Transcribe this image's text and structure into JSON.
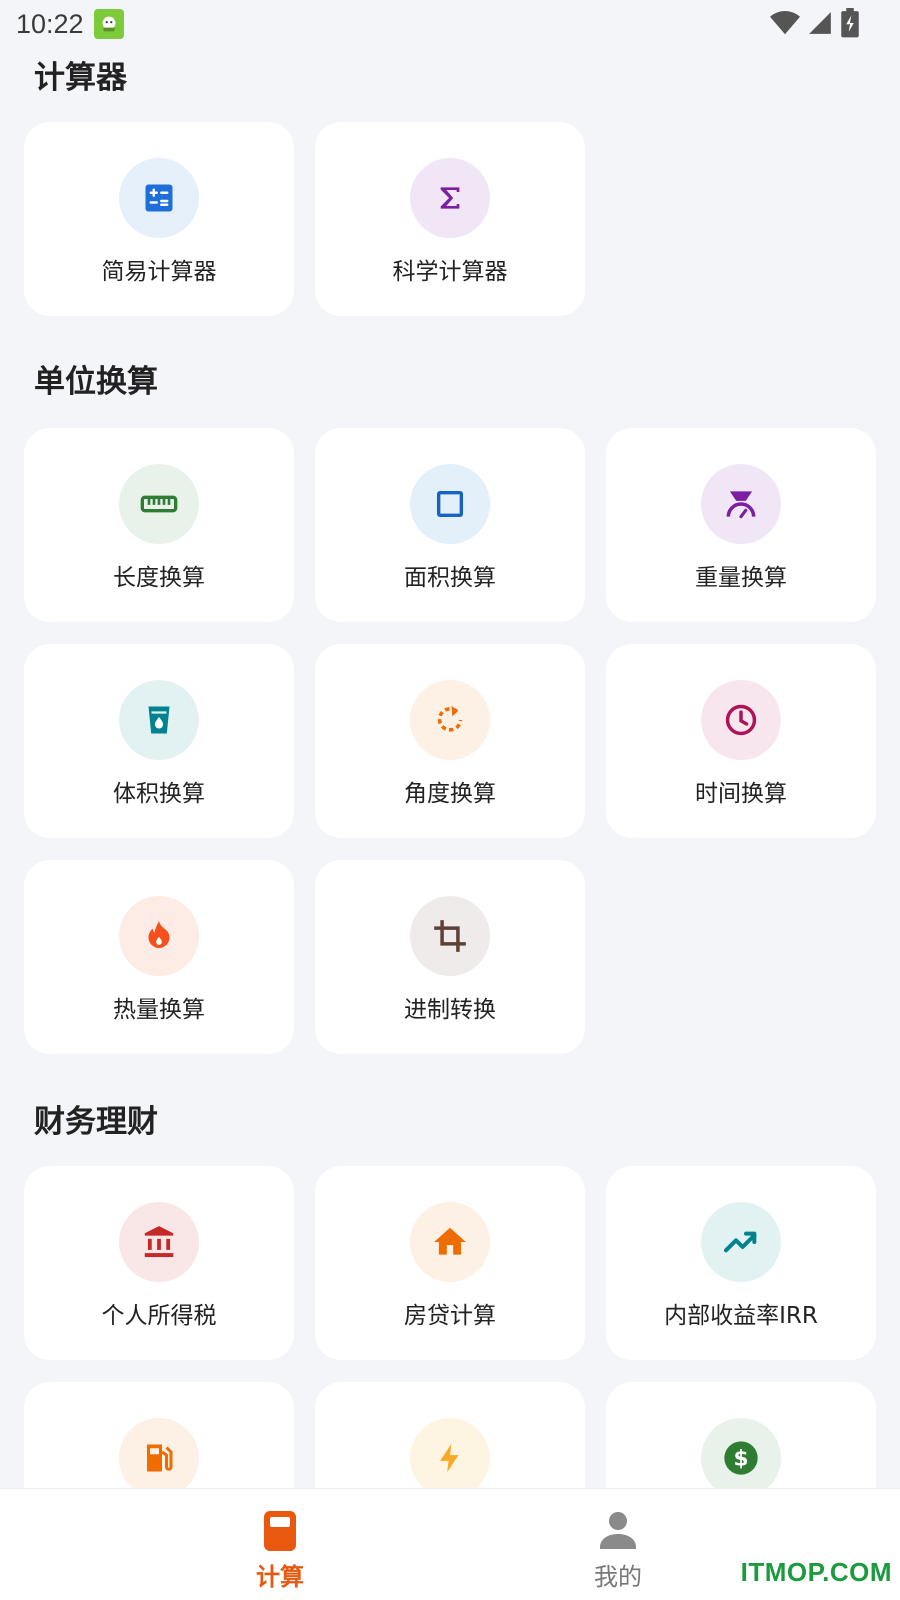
{
  "status_bar": {
    "time": "10:22",
    "icons": [
      "app-notification-icon",
      "wifi-icon",
      "cellular-signal-icon",
      "battery-charging-icon"
    ]
  },
  "sections": [
    {
      "title": "计算器",
      "items": [
        {
          "label": "简易计算器",
          "icon": "calculator-icon",
          "color": "#1e6fd9",
          "bg": "#e6f0fb"
        },
        {
          "label": "科学计算器",
          "icon": "sigma-icon",
          "color": "#7b1fa2",
          "bg": "#f1e6f6"
        }
      ]
    },
    {
      "title": "单位换算",
      "items": [
        {
          "label": "长度换算",
          "icon": "ruler-icon",
          "color": "#2e7d32",
          "bg": "#e8f2ea"
        },
        {
          "label": "面积换算",
          "icon": "square-icon",
          "color": "#1565c0",
          "bg": "#e3eff9"
        },
        {
          "label": "重量换算",
          "icon": "scale-icon",
          "color": "#7b1fa2",
          "bg": "#f1e6f6"
        },
        {
          "label": "体积换算",
          "icon": "cup-icon",
          "color": "#00838f",
          "bg": "#e2f2f3"
        },
        {
          "label": "角度换算",
          "icon": "rotate-icon",
          "color": "#ef6c00",
          "bg": "#fdf0e4"
        },
        {
          "label": "时间换算",
          "icon": "clock-icon",
          "color": "#ad1457",
          "bg": "#f8e6ee"
        },
        {
          "label": "热量换算",
          "icon": "fire-icon",
          "color": "#f4511e",
          "bg": "#fdebe6"
        },
        {
          "label": "进制转换",
          "icon": "crop-icon",
          "color": "#5d4037",
          "bg": "#efebea"
        }
      ]
    },
    {
      "title": "财务理财",
      "items": [
        {
          "label": "个人所得税",
          "icon": "bank-icon",
          "color": "#c62828",
          "bg": "#f9e7e7"
        },
        {
          "label": "房贷计算",
          "icon": "home-icon",
          "color": "#ef6c00",
          "bg": "#fdf0e4"
        },
        {
          "label": "内部收益率IRR",
          "icon": "trending-up-icon",
          "color": "#00838f",
          "bg": "#e2f2f3"
        },
        {
          "label": "",
          "icon": "fuel-icon",
          "color": "#ef6c00",
          "bg": "#fdf0e4"
        },
        {
          "label": "",
          "icon": "bolt-icon",
          "color": "#f9a825",
          "bg": "#fdf5e1"
        },
        {
          "label": "",
          "icon": "dollar-icon",
          "color": "#2e7d32",
          "bg": "#e8f2ea"
        }
      ]
    }
  ],
  "bottom_nav": {
    "items": [
      {
        "label": "计算",
        "icon": "calculator-tab-icon",
        "active": true,
        "color": "#e8580e"
      },
      {
        "label": "我的",
        "icon": "person-icon",
        "active": false,
        "color": "#8a8a8a"
      }
    ]
  },
  "watermark": "ITMOP.COM"
}
